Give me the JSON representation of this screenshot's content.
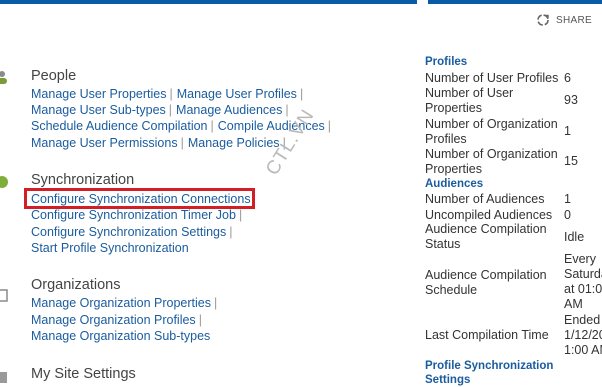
{
  "share": {
    "label": "SHARE"
  },
  "people": {
    "title": "People",
    "links": [
      [
        "Manage User Properties",
        "Manage User Profiles"
      ],
      [
        "Manage User Sub-types",
        "Manage Audiences"
      ],
      [
        "Schedule Audience Compilation",
        "Compile Audiences"
      ],
      [
        "Manage User Permissions",
        "Manage Policies"
      ]
    ]
  },
  "sync": {
    "title": "Synchronization",
    "links": [
      "Configure Synchronization Connections",
      "Configure Synchronization Timer Job",
      "Configure Synchronization Settings",
      "Start Profile Synchronization"
    ]
  },
  "orgs": {
    "title": "Organizations",
    "links": [
      "Manage Organization Properties",
      "Manage Organization Profiles",
      "Manage Organization Sub-types"
    ]
  },
  "mysite": {
    "title": "My Site Settings"
  },
  "watermark": "CTL.VN",
  "stats": {
    "profiles_heading": "Profiles",
    "num_user_profiles_label": "Number of User Profiles",
    "num_user_profiles_value": "6",
    "num_user_properties_label": "Number of User Properties",
    "num_user_properties_value": "93",
    "num_org_profiles_label": "Number of Organization Profiles",
    "num_org_profiles_value": "1",
    "num_org_properties_label": "Number of Organization Properties",
    "num_org_properties_value": "15",
    "audiences_heading": "Audiences",
    "num_audiences_label": "Number of Audiences",
    "num_audiences_value": "1",
    "uncompiled_label": "Uncompiled Audiences",
    "uncompiled_value": "0",
    "compilation_status_label": "Audience Compilation Status",
    "compilation_status_value": "Idle",
    "compilation_schedule_label": "Audience Compilation Schedule",
    "compilation_schedule_value": [
      "Every",
      "Saturday",
      "at 01:0",
      "AM"
    ],
    "last_compilation_label": "Last Compilation Time",
    "last_compilation_value": [
      "Ended",
      "1/12/20",
      "1:00 AM"
    ],
    "sync_heading": "Profile Synchronization Settings"
  }
}
